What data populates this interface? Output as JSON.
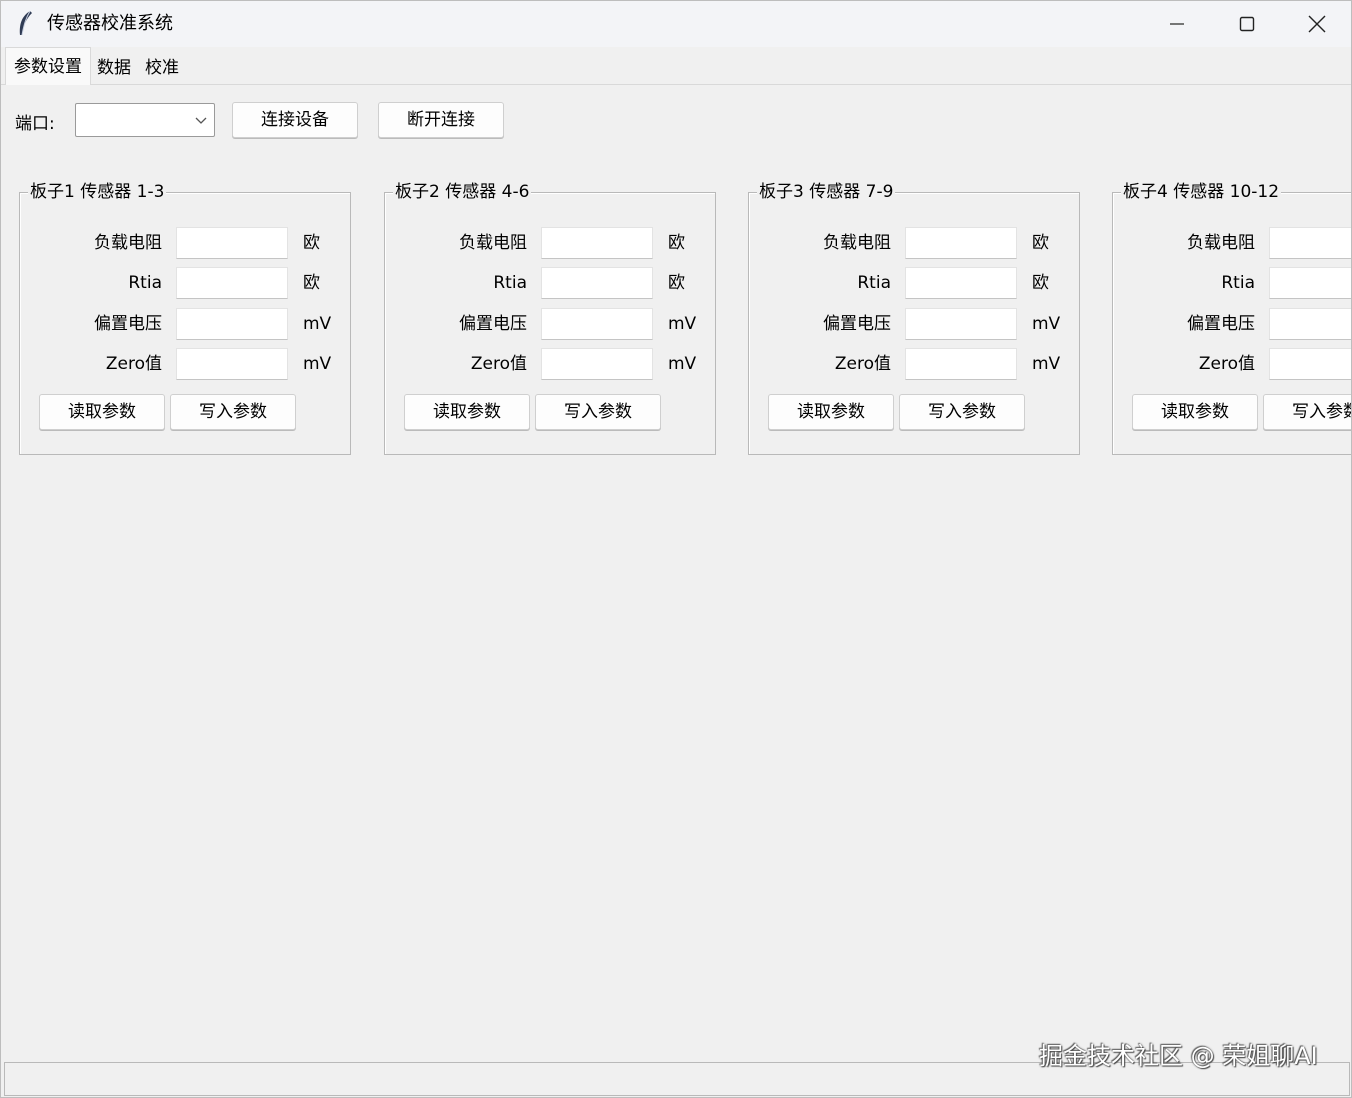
{
  "window": {
    "title": "传感器校准系统",
    "minimize_icon": "minimize-icon",
    "maximize_icon": "maximize-icon",
    "close_icon": "close-icon"
  },
  "tabs": [
    {
      "label": "参数设置",
      "active": true
    },
    {
      "label": "数据",
      "active": false
    },
    {
      "label": "校准",
      "active": false
    }
  ],
  "toolbar": {
    "port_label": "端口:",
    "port_value": "",
    "connect_label": "连接设备",
    "disconnect_label": "断开连接"
  },
  "boards": [
    {
      "title": "板子1 传感器 1-3",
      "fields": [
        {
          "label": "负载电阻",
          "value": "",
          "unit": "欧"
        },
        {
          "label": "Rtia",
          "value": "",
          "unit": "欧"
        },
        {
          "label": "偏置电压",
          "value": "",
          "unit": "mV"
        },
        {
          "label": "Zero值",
          "value": "",
          "unit": "mV"
        }
      ],
      "read_label": "读取参数",
      "write_label": "写入参数"
    },
    {
      "title": "板子2 传感器 4-6",
      "fields": [
        {
          "label": "负载电阻",
          "value": "",
          "unit": "欧"
        },
        {
          "label": "Rtia",
          "value": "",
          "unit": "欧"
        },
        {
          "label": "偏置电压",
          "value": "",
          "unit": "mV"
        },
        {
          "label": "Zero值",
          "value": "",
          "unit": "mV"
        }
      ],
      "read_label": "读取参数",
      "write_label": "写入参数"
    },
    {
      "title": "板子3 传感器 7-9",
      "fields": [
        {
          "label": "负载电阻",
          "value": "",
          "unit": "欧"
        },
        {
          "label": "Rtia",
          "value": "",
          "unit": "欧"
        },
        {
          "label": "偏置电压",
          "value": "",
          "unit": "mV"
        },
        {
          "label": "Zero值",
          "value": "",
          "unit": "mV"
        }
      ],
      "read_label": "读取参数",
      "write_label": "写入参数"
    },
    {
      "title": "板子4 传感器 10-12",
      "fields": [
        {
          "label": "负载电阻",
          "value": "",
          "unit": ""
        },
        {
          "label": "Rtia",
          "value": "",
          "unit": ""
        },
        {
          "label": "偏置电压",
          "value": "",
          "unit": ""
        },
        {
          "label": "Zero值",
          "value": "",
          "unit": ""
        }
      ],
      "read_label": "读取参数",
      "write_label": "写入参数"
    }
  ],
  "statusbar": {
    "text": ""
  },
  "watermark": "掘金技术社区 @ 荣姐聊AI"
}
